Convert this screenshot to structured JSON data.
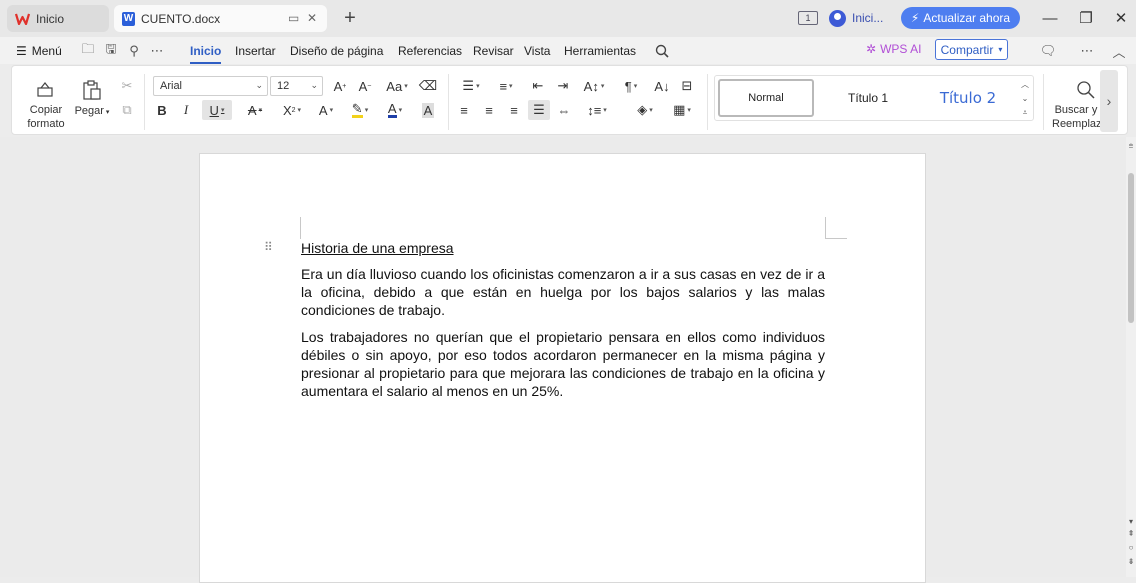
{
  "tabs": {
    "home": {
      "label": "Inicio",
      "icon": "wps-logo-icon"
    },
    "doc": {
      "label": "CUENTO.docx",
      "icon": "word-doc-icon"
    },
    "new_tab": "+"
  },
  "titlebar": {
    "page_badge": "1",
    "user": "Inici...",
    "upgrade": "Actualizar ahora"
  },
  "menubar": {
    "menu": "Menú",
    "items": [
      "Inicio",
      "Insertar",
      "Diseño de página",
      "Referencias",
      "Revisar",
      "Vista",
      "Herramientas"
    ],
    "wps_ai": "WPS AI",
    "share": "Compartir"
  },
  "ribbon": {
    "copy_format": "Copiar formato",
    "paste": "Pegar",
    "font_name": "Arial",
    "font_size": "12",
    "styles": [
      "Normal",
      "Título 1",
      "Título 2"
    ],
    "find": "Buscar y Reemplazar"
  },
  "document": {
    "title": "Historia de una empresa",
    "paragraphs": [
      "Era un día lluvioso cuando los oficinistas comenzaron a ir a sus casas en vez de ir a la oficina, debido a que están en huelga por los bajos salarios y las malas condiciones de trabajo.",
      "Los trabajadores no querían que el propietario pensara en ellos como individuos débiles o sin apoyo, por eso todos acordaron permanecer en la misma página y presionar al propietario para que mejorara las condiciones de trabajo en la oficina y aumentara el salario al menos en un 25%."
    ]
  },
  "colors": {
    "accent": "#2f5ec4",
    "upgrade": "#4e7ef0",
    "wps_ai": "#b14fd6"
  }
}
